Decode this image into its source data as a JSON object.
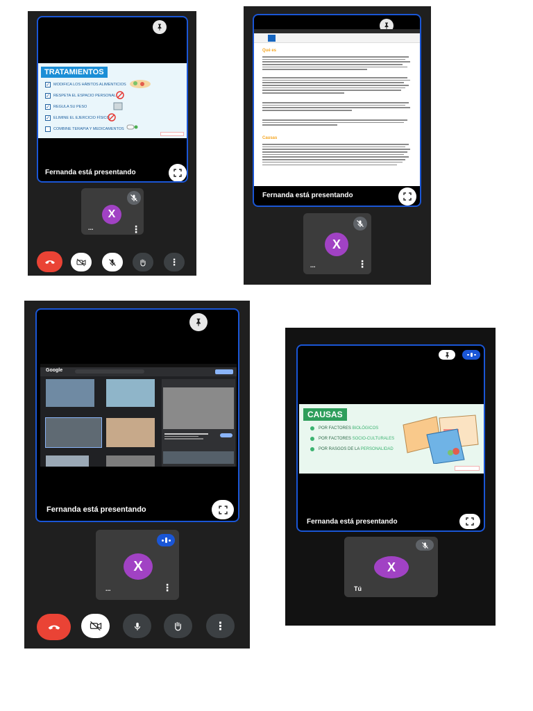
{
  "presenting_label": "Fernanda está presentando",
  "participant": {
    "initial": "X",
    "name_ellipsis": "...",
    "self_name": "Tú"
  },
  "slide_tratamientos": {
    "title": "TRATAMIENTOS",
    "items": [
      "MODIFICA LOS HÁBITOS ALIMENTICIOS",
      "RESPETA EL ESPACIO PERSONAL",
      "REGULA SU PESO",
      "ELIMINE EL EJERCICIO FÍSICO",
      "COMBINE TERAPIA Y MEDICAMENTOS"
    ]
  },
  "document": {
    "heading_1": "Qué es",
    "heading_2": "Causas"
  },
  "google": {
    "logo": "Google"
  },
  "slide_causas": {
    "title": "CAUSAS",
    "items": [
      {
        "prefix": "POR FACTORES ",
        "highlight": "BIOLÓGICOS"
      },
      {
        "prefix": "POR FACTORES ",
        "highlight": "SOCIO-CULTURALES"
      },
      {
        "prefix": "POR RASGOS DE LA ",
        "highlight": "PERSONALIDAD"
      }
    ]
  },
  "icons": [
    "pin-icon",
    "fullscreen-icon",
    "mic-off-icon",
    "mic-icon",
    "camera-off-icon",
    "hand-icon",
    "more-vert-icon",
    "end-call-icon"
  ],
  "colors": {
    "accent": "#1a56d6",
    "avatar": "#a142c4",
    "end_call": "#ea4335"
  }
}
